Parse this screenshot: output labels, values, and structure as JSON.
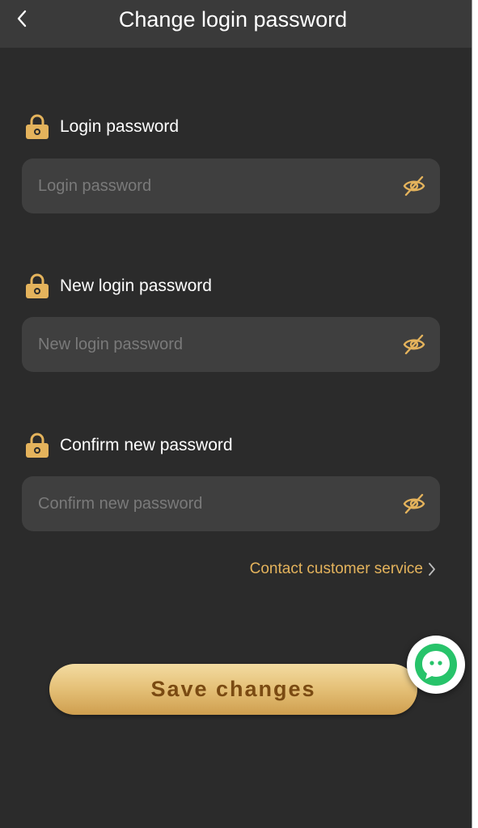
{
  "header": {
    "title": "Change login password",
    "back_icon": "chevron-left-icon"
  },
  "fields": [
    {
      "label": "Login password",
      "placeholder": "Login password",
      "value": "",
      "icon": "lock-icon",
      "toggle_icon": "eye-off-icon"
    },
    {
      "label": "New login password",
      "placeholder": "New login password",
      "value": "",
      "icon": "lock-icon",
      "toggle_icon": "eye-off-icon"
    },
    {
      "label": "Confirm new password",
      "placeholder": "Confirm new password",
      "value": "",
      "icon": "lock-icon",
      "toggle_icon": "eye-off-icon"
    }
  ],
  "contact": {
    "label": "Contact customer service",
    "icon": "chevron-right-icon"
  },
  "save_button": {
    "label": "Save changes"
  },
  "chat_fab": {
    "icon": "chat-bubble-icon"
  },
  "colors": {
    "background": "#2b2b2b",
    "header": "#3a3a3a",
    "field": "#3f3f3f",
    "accent_gold": "#e4b35c",
    "chat_green": "#27c36a"
  }
}
